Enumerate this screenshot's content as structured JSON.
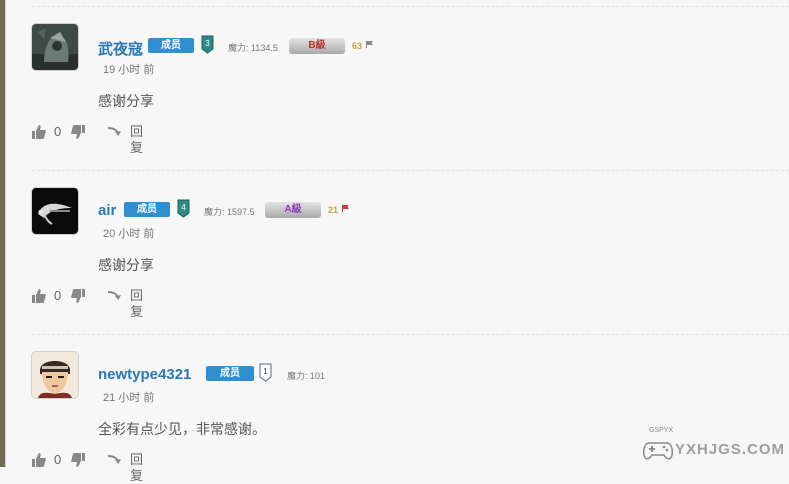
{
  "comments": [
    {
      "username": "武夜寇",
      "role": "成员",
      "level": "3",
      "level_color": "#2d8a86",
      "power": "魔力: 1134.5",
      "medal": "B級",
      "medal_color": "#b8322b",
      "points": "63",
      "flag_color": "#888888",
      "time": "19 小时 前",
      "text": "感谢分享",
      "votes": "0",
      "reply": "回复"
    },
    {
      "username": "air",
      "role": "成员",
      "level": "4",
      "level_color": "#2d8a86",
      "power": "魔力: 1597.5",
      "medal": "A級",
      "medal_color": "#8a3bb5",
      "points": "21",
      "flag_color": "#d33b3b",
      "time": "20 小时 前",
      "text": "感谢分享",
      "votes": "0",
      "reply": "回复"
    },
    {
      "username": "newtype4321",
      "role": "成员",
      "level": "1",
      "level_color": "#ffffff",
      "power": "魔力: 101",
      "time": "21 小时 前",
      "text": "全彩有点少见，非常感谢。",
      "votes": "0",
      "reply": "回复"
    }
  ],
  "watermark": {
    "text": "YXHJGS.COM",
    "small": "GSPYX"
  }
}
